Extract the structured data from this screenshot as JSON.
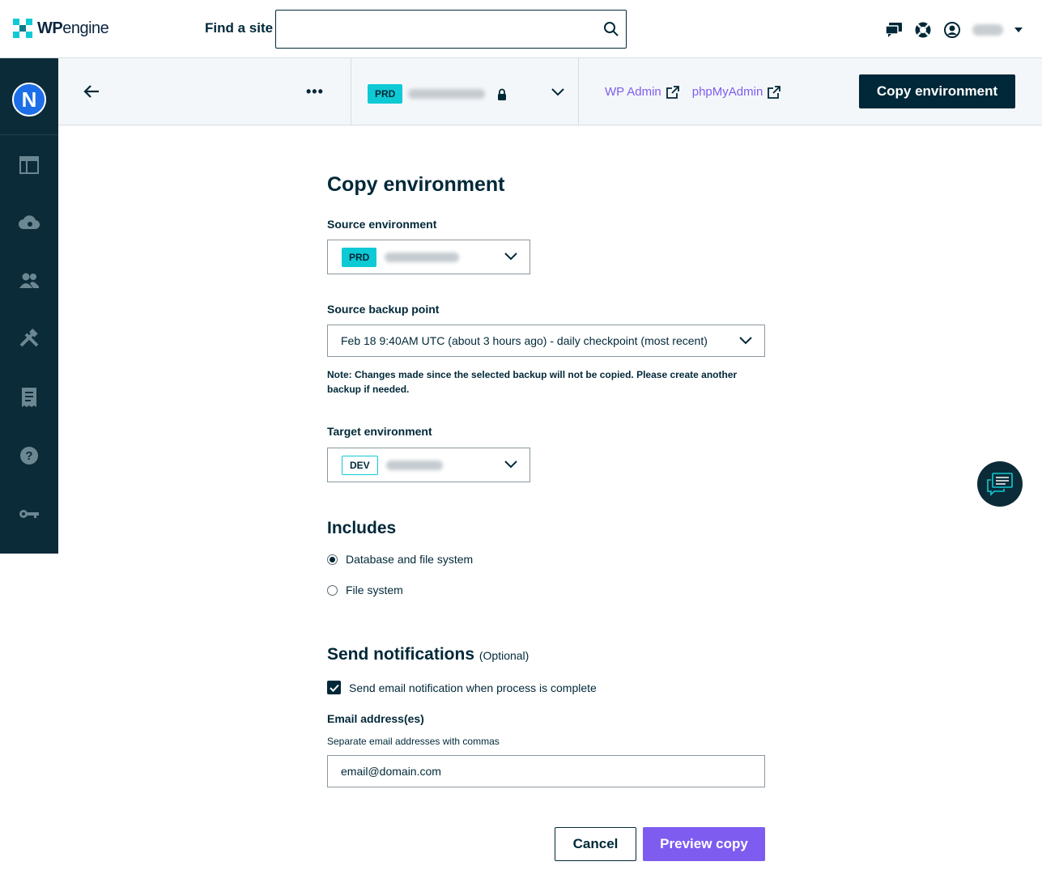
{
  "topbar": {
    "logo_text_bold": "WP",
    "logo_text_light": "engine",
    "find_label": "Find a site",
    "search_placeholder": ""
  },
  "sidebar": {
    "avatar_letter": "N",
    "items": [
      {
        "icon": "dashboard-icon"
      },
      {
        "icon": "cloud-icon"
      },
      {
        "icon": "users-icon"
      },
      {
        "icon": "tools-icon"
      },
      {
        "icon": "billing-icon"
      },
      {
        "icon": "help-icon"
      },
      {
        "icon": "key-icon"
      }
    ]
  },
  "subheader": {
    "more_label": "•••",
    "env_tag": "PRD",
    "links": {
      "wp_admin": "WP Admin",
      "phpmyadmin": "phpMyAdmin"
    },
    "copy_env_label": "Copy environment"
  },
  "form": {
    "title": "Copy environment",
    "source_env_label": "Source environment",
    "source_env_tag": "PRD",
    "source_backup_label": "Source backup point",
    "source_backup_value": "Feb 18 9:40AM UTC (about 3 hours ago) - daily checkpoint (most recent)",
    "note": "Note: Changes made since the selected backup will not be copied. Please create another backup if needed.",
    "target_env_label": "Target environment",
    "target_env_tag": "DEV",
    "includes_heading": "Includes",
    "includes_options": [
      {
        "label": "Database and file system",
        "selected": true
      },
      {
        "label": "File system",
        "selected": false
      }
    ],
    "notifications_heading": "Send notifications",
    "notifications_optional": "(Optional)",
    "send_email_label": "Send email notification when process is complete",
    "send_email_checked": true,
    "email_label": "Email address(es)",
    "email_helper": "Separate email addresses with commas",
    "email_value": "email@domain.com",
    "cancel_label": "Cancel",
    "preview_label": "Preview copy"
  },
  "colors": {
    "navy": "#002838",
    "sidebar": "#0c2b38",
    "teal": "#0ecad4",
    "purple": "#7e5cef"
  }
}
